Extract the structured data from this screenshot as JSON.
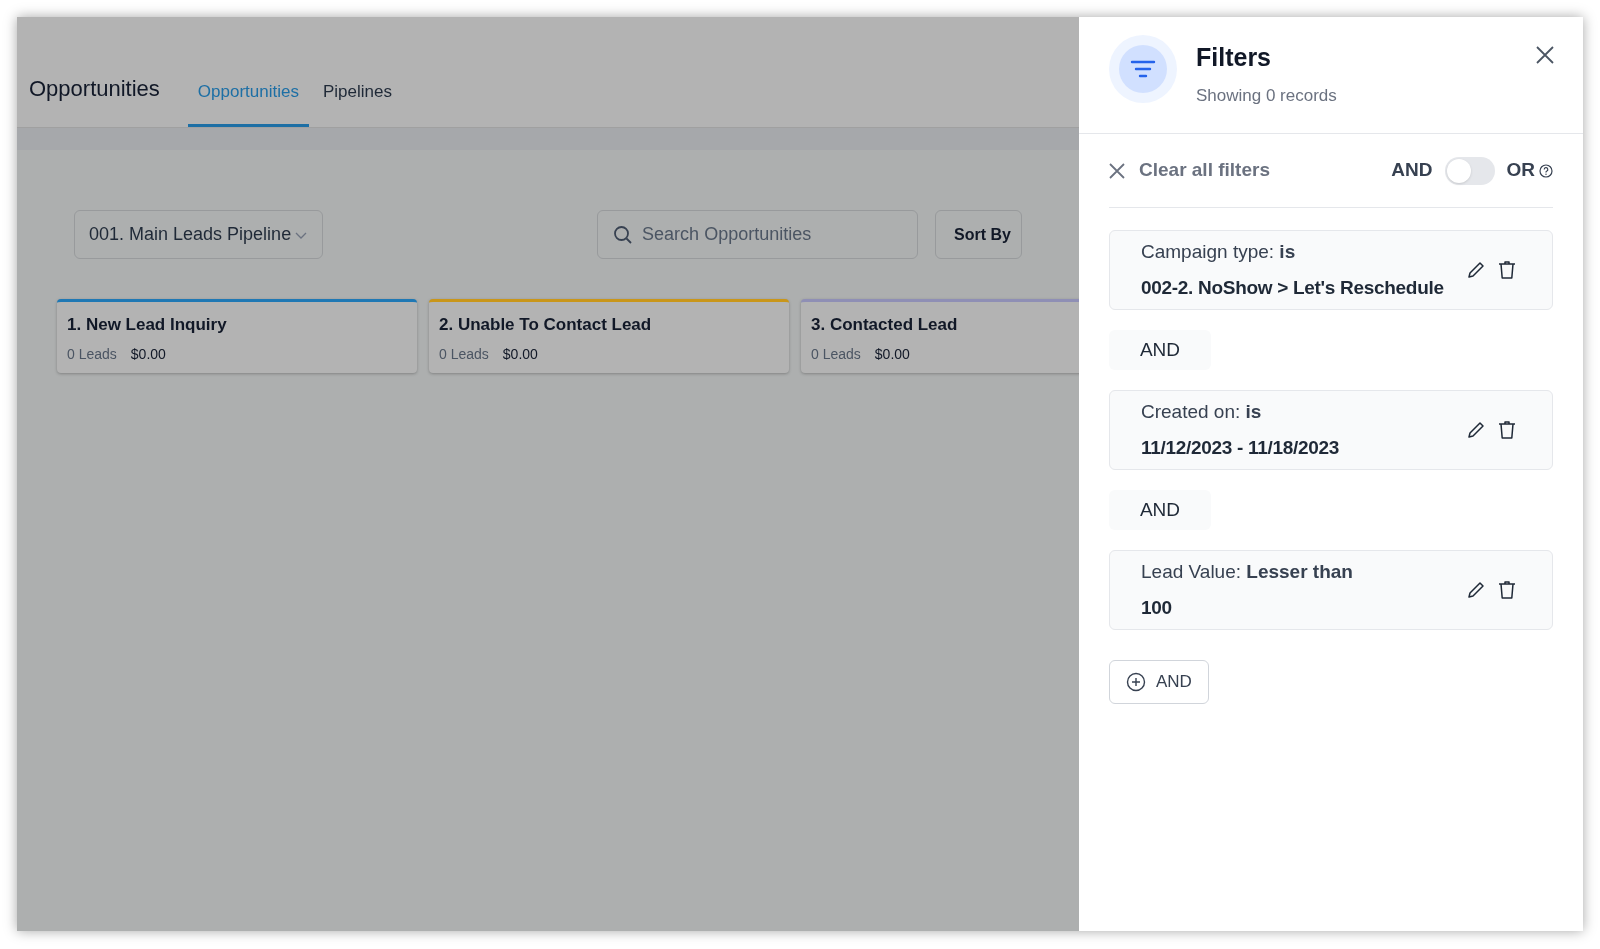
{
  "page": {
    "title": "Opportunities",
    "tabs": [
      {
        "label": "Opportunities",
        "selected": true
      },
      {
        "label": "Pipelines",
        "selected": false
      }
    ],
    "pipeline_select": {
      "value": "001. Main Leads Pipeline"
    },
    "search": {
      "placeholder": "Search Opportunities"
    },
    "sort_button": "Sort By",
    "stages": [
      {
        "name": "1. New Lead Inquiry",
        "count": "0 Leads",
        "amount": "$0.00",
        "color": "#1f78b4"
      },
      {
        "name": "2. Unable To Contact Lead",
        "count": "0 Leads",
        "amount": "$0.00",
        "color": "#c9961a"
      },
      {
        "name": "3. Contacted Lead",
        "count": "0 Leads",
        "amount": "$0.00",
        "color": "#8f8fb5"
      }
    ]
  },
  "filters_panel": {
    "title": "Filters",
    "subtitle": "Showing 0 records",
    "clear_all": "Clear all filters",
    "logic": {
      "left": "AND",
      "right": "OR",
      "on": false
    },
    "filters": [
      {
        "condition": "Campaign type: **is**",
        "value": "002-2. NoShow > Let's Reschedule"
      },
      {
        "condition": "Created on: **is**",
        "value": "11/12/2023 - 11/18/2023"
      },
      {
        "condition": "Lead Value: **Lesser than**",
        "value": "100"
      }
    ],
    "joiners": [
      "AND",
      "AND"
    ],
    "add_button": "AND"
  }
}
